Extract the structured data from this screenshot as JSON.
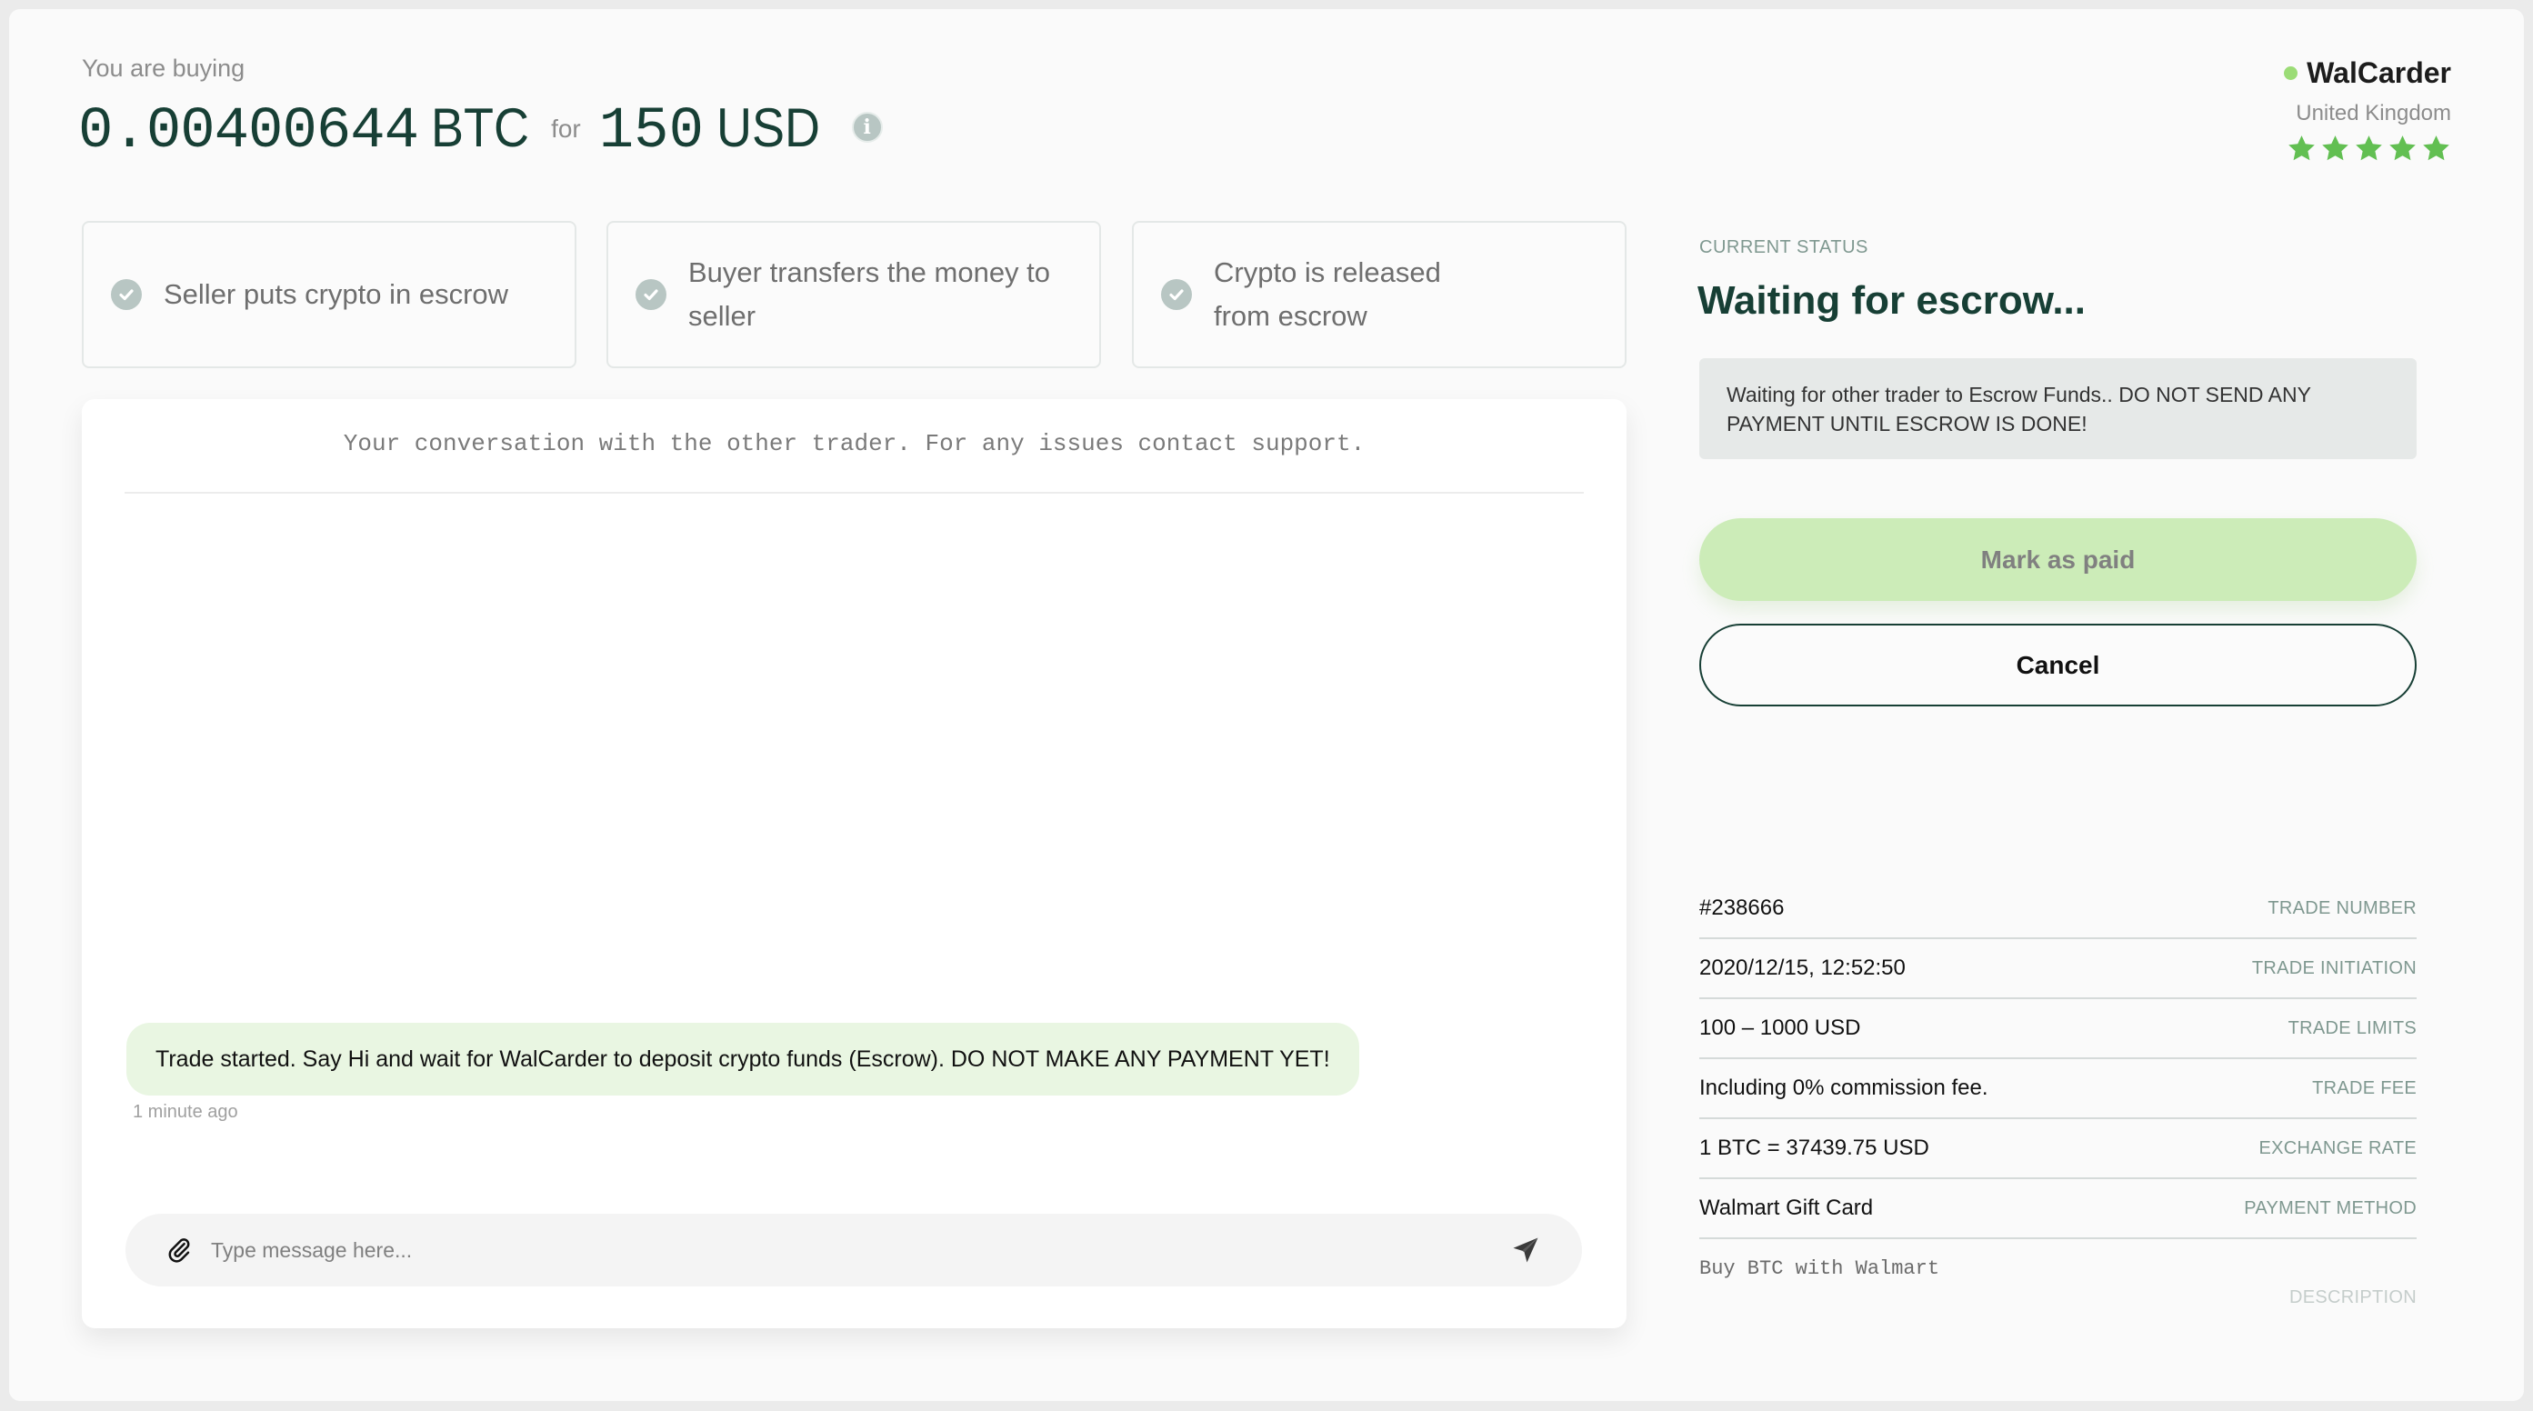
{
  "header": {
    "buying_label": "You are buying",
    "crypto_amount": "0.00400644",
    "crypto_unit": "BTC",
    "for_label": "for",
    "fiat_amount": "150",
    "fiat_unit": "USD",
    "info_icon": "info-icon"
  },
  "trader": {
    "name": "WalCarder",
    "online": true,
    "country": "United Kingdom",
    "rating": 5,
    "rating_max": 5
  },
  "steps": [
    {
      "label": "Seller puts crypto in escrow",
      "icon": "check-circle-icon"
    },
    {
      "label": "Buyer transfers the money to seller",
      "icon": "check-circle-icon"
    },
    {
      "label": "Crypto is released from escrow",
      "icon": "check-circle-icon"
    }
  ],
  "chat": {
    "header": "Your conversation with the other trader. For any issues contact support.",
    "messages": [
      {
        "text": "Trade started. Say Hi and wait for WalCarder to deposit crypto funds (Escrow). DO NOT MAKE ANY PAYMENT YET!",
        "time": "1 minute ago"
      }
    ],
    "input_placeholder": "Type message here...",
    "input_value": ""
  },
  "status": {
    "label": "CURRENT STATUS",
    "title": "Waiting for escrow...",
    "message": "Waiting for other trader to Escrow Funds.. DO NOT SEND ANY PAYMENT UNTIL ESCROW IS DONE!",
    "mark_paid_label": "Mark as paid",
    "cancel_label": "Cancel"
  },
  "details": [
    {
      "value": "#238666",
      "label": "TRADE NUMBER"
    },
    {
      "value": "2020/12/15, 12:52:50",
      "label": "TRADE INITIATION"
    },
    {
      "value": "100 – 1000 USD",
      "label": "TRADE LIMITS"
    },
    {
      "value": "Including 0% commission fee.",
      "label": "TRADE FEE"
    },
    {
      "value": "1 BTC = 37439.75 USD",
      "label": "EXCHANGE RATE"
    },
    {
      "value": "Walmart Gift Card",
      "label": "PAYMENT METHOD"
    }
  ],
  "description": {
    "value": "Buy BTC with Walmart",
    "label": "DESCRIPTION"
  },
  "colors": {
    "brand_dark_green": "#173f35",
    "accent_green": "#62bf52",
    "online_dot": "#9bdc76",
    "mark_paid_bg": "#ccecb8",
    "bubble_bg": "#e9f6e2"
  }
}
